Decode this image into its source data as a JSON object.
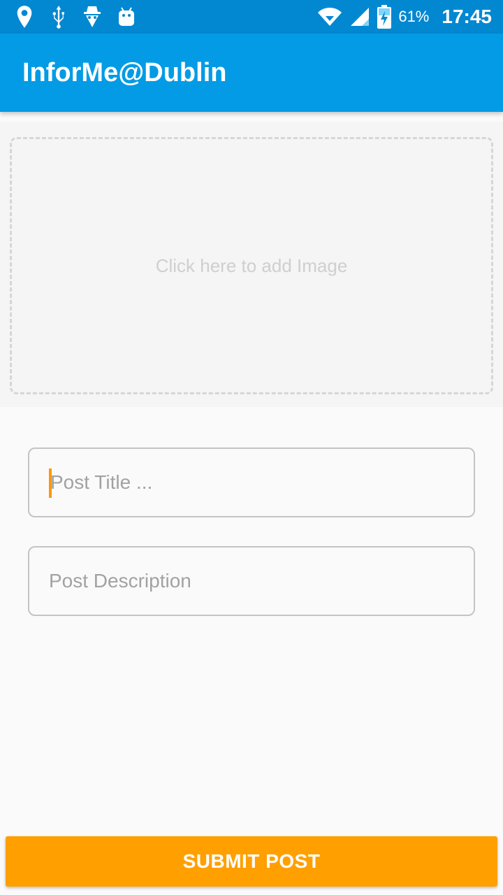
{
  "status_bar": {
    "left_icons": [
      "location-pin-icon",
      "usb-icon",
      "incognito-icon",
      "android-icon"
    ],
    "right_icons": [
      "wifi-icon",
      "cell-signal-icon",
      "battery-charging-icon"
    ],
    "battery_percent": "61%",
    "time": "17:45"
  },
  "app_bar": {
    "title": "InforMe@Dublin"
  },
  "image_picker": {
    "label": "Click here to add Image"
  },
  "form": {
    "title_placeholder": "Post Title ...",
    "description_placeholder": "Post Description"
  },
  "submit": {
    "label": "SUBMIT POST"
  },
  "colors": {
    "status_bar": "#0288d1",
    "app_bar": "#039be5",
    "accent": "#ffa000",
    "background": "#fafafa"
  }
}
